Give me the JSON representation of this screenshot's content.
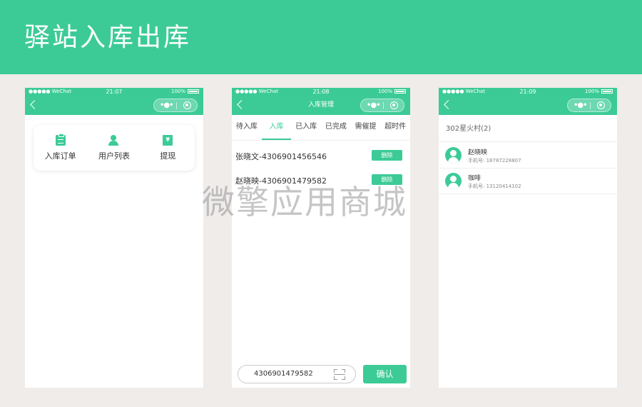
{
  "banner": {
    "title": "驿站入库出库"
  },
  "watermark": "微擎应用商城",
  "status_common": {
    "carrier": "●●●●● WeChat",
    "battery": "100%"
  },
  "phone1": {
    "time": "21:07",
    "menu": [
      {
        "label": "入库订单",
        "icon": "clipboard-icon"
      },
      {
        "label": "用户列表",
        "icon": "user-icon"
      },
      {
        "label": "提现",
        "icon": "money-icon"
      }
    ],
    "money_symbol": "¥"
  },
  "phone2": {
    "time": "21:08",
    "nav_title": "入库管理",
    "tabs": [
      "待入库",
      "入库",
      "已入库",
      "已完成",
      "需催提",
      "超时件"
    ],
    "active_tab": 1,
    "orders": [
      {
        "text": "张晓文-4306901456546",
        "action": "删除"
      },
      {
        "text": "赵晓映-4306901479582",
        "action": "删除"
      }
    ],
    "scan_value": "4306901479582",
    "confirm_label": "确认"
  },
  "phone3": {
    "time": "21:09",
    "group_title": "302星火村(2)",
    "contacts": [
      {
        "name": "赵晓映",
        "phone": "手机号: 18787228807"
      },
      {
        "name": "咖啡",
        "phone": "手机号: 13120414102"
      }
    ]
  },
  "colors": {
    "accent": "#3ccb97",
    "background": "#efecea"
  }
}
